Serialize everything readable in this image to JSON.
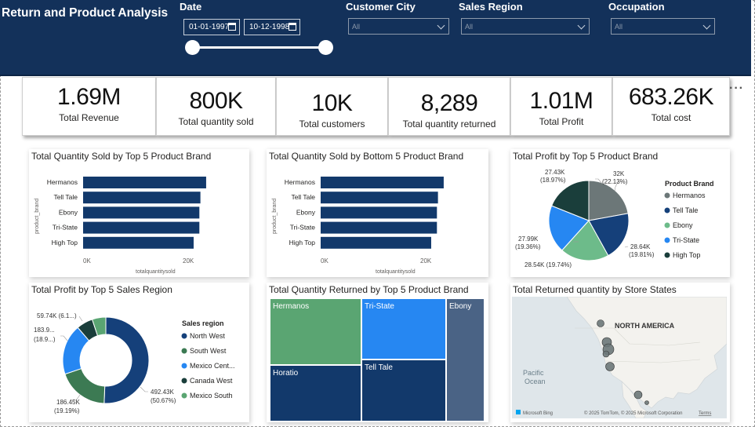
{
  "header": {
    "title": "Return and Product Analysis",
    "date": {
      "label": "Date",
      "start": "01-01-1997",
      "end": "10-12-1998"
    },
    "slicers": [
      {
        "id": "customer-city",
        "label": "Customer City",
        "value": "All"
      },
      {
        "id": "sales-region",
        "label": "Sales Region",
        "value": "All"
      },
      {
        "id": "occupation",
        "label": "Occupation",
        "value": "All"
      }
    ]
  },
  "kpis": [
    {
      "value": "1.69M",
      "label": "Total Revenue"
    },
    {
      "value": "800K",
      "label": "Total quantity sold"
    },
    {
      "value": "10K",
      "label": "Total customers"
    },
    {
      "value": "8,289",
      "label": "Total quantity returned"
    },
    {
      "value": "1.01M",
      "label": "Total Profit"
    },
    {
      "value": "683.26K",
      "label": "Total cost"
    }
  ],
  "colors": {
    "header_bg": "#13315a",
    "navy": "#12396b",
    "gray": "#6c7778",
    "navy2": "#15407a",
    "green": "#6dbb8a",
    "blue": "#2687f2",
    "dark_teal": "#1a3e3b",
    "sw_green": "#3c7a53",
    "tm_green": "#5aa572",
    "tm_blue": "#2687f2",
    "tm_slate": "#4a6385"
  },
  "charts": {
    "top5_sold": {
      "title": "Total Quantity Sold by Top 5 Product Brand",
      "ylabel": "product_brand",
      "xlabel": "totalquantitysold",
      "ticks": [
        "0K",
        "20K"
      ]
    },
    "bottom5_sold": {
      "title": "Total Quantity Sold by Bottom 5 Product Brand",
      "ylabel": "product_brand",
      "xlabel": "totalquantitysold",
      "ticks": [
        "0K",
        "20K"
      ]
    },
    "profit_brand": {
      "title": "Total Profit by Top 5 Product Brand",
      "legend_title": "Product Brand",
      "labels": [
        {
          "line1": "32K",
          "line2": "(22.13%)"
        },
        {
          "line1": "28.64K",
          "line2": "(19.81%)"
        },
        {
          "line1": "28.54K (19.74%)",
          "line2": ""
        },
        {
          "line1": "27.99K",
          "line2": "(19.36%)"
        },
        {
          "line1": "27.43K",
          "line2": "(18.97%)"
        }
      ]
    },
    "profit_region": {
      "title": "Total Profit by Top 5 Sales Region",
      "legend_title": "Sales region",
      "legend_items": [
        "North West",
        "South West",
        "Mexico Cent...",
        "Canada West",
        "Mexico South"
      ],
      "labels": [
        {
          "line1": "492.43K",
          "line2": "(50.67%)"
        },
        {
          "line1": "186.45K",
          "line2": "(19.19%)"
        },
        {
          "line1": "183.9...",
          "line2": "(18.9...)"
        },
        {
          "line1": "59.74K (6.1...)",
          "line2": ""
        }
      ]
    },
    "returned_brand": {
      "title": "Total Quantity Returned by Top 5 Product Brand",
      "tiles": [
        "Hermanos",
        "Tri-State",
        "Ebony",
        "Horatio",
        "Tell Tale"
      ]
    },
    "map": {
      "title": "Total Returned quantity by Store States",
      "continent": "NORTH AMERICA",
      "ocean_line1": "Pacific",
      "ocean_line2": "Ocean",
      "brand": "Microsoft Bing",
      "copyright": "© 2025 TomTom, © 2025 Microsoft Corporation",
      "terms": "Terms"
    }
  },
  "chart_data": [
    {
      "type": "bar",
      "title": "Total Quantity Sold by Top 5 Product Brand",
      "xlabel": "totalquantitysold",
      "ylabel": "product_brand",
      "categories": [
        "Hermanos",
        "Tell Tale",
        "Ebony",
        "Tri-State",
        "High Top"
      ],
      "values": [
        23600,
        22500,
        22300,
        22300,
        21200
      ],
      "xlim": [
        0,
        30000
      ],
      "orientation": "horizontal"
    },
    {
      "type": "bar",
      "title": "Total Quantity Sold by Bottom 5 Product Brand",
      "xlabel": "totalquantitysold",
      "ylabel": "product_brand",
      "categories": [
        "Hermanos",
        "Tell Tale",
        "Ebony",
        "Tri-State",
        "High Top"
      ],
      "values": [
        23600,
        22500,
        22300,
        22300,
        21200
      ],
      "xlim": [
        0,
        30000
      ],
      "orientation": "horizontal"
    },
    {
      "type": "pie",
      "title": "Total Profit by Top 5 Product Brand",
      "categories": [
        "Hermanos",
        "Tell Tale",
        "Ebony",
        "Tri-State",
        "High Top"
      ],
      "values": [
        32000,
        28640,
        28540,
        27990,
        27430
      ],
      "percents": [
        22.13,
        19.81,
        19.74,
        19.36,
        18.97
      ]
    },
    {
      "type": "pie",
      "title": "Total Profit by Top 5 Sales Region",
      "categories": [
        "North West",
        "South West",
        "Mexico Cent...",
        "Canada West",
        "Mexico South"
      ],
      "values": [
        492430,
        186450,
        183900,
        59740,
        50000
      ],
      "percents": [
        50.67,
        19.19,
        18.9,
        6.1,
        5.14
      ],
      "donut": true
    },
    {
      "type": "heatmap",
      "title": "Total Quantity Returned by Top 5 Product Brand",
      "categories": [
        "Hermanos",
        "Tri-State",
        "Ebony",
        "Horatio",
        "Tell Tale"
      ]
    }
  ]
}
